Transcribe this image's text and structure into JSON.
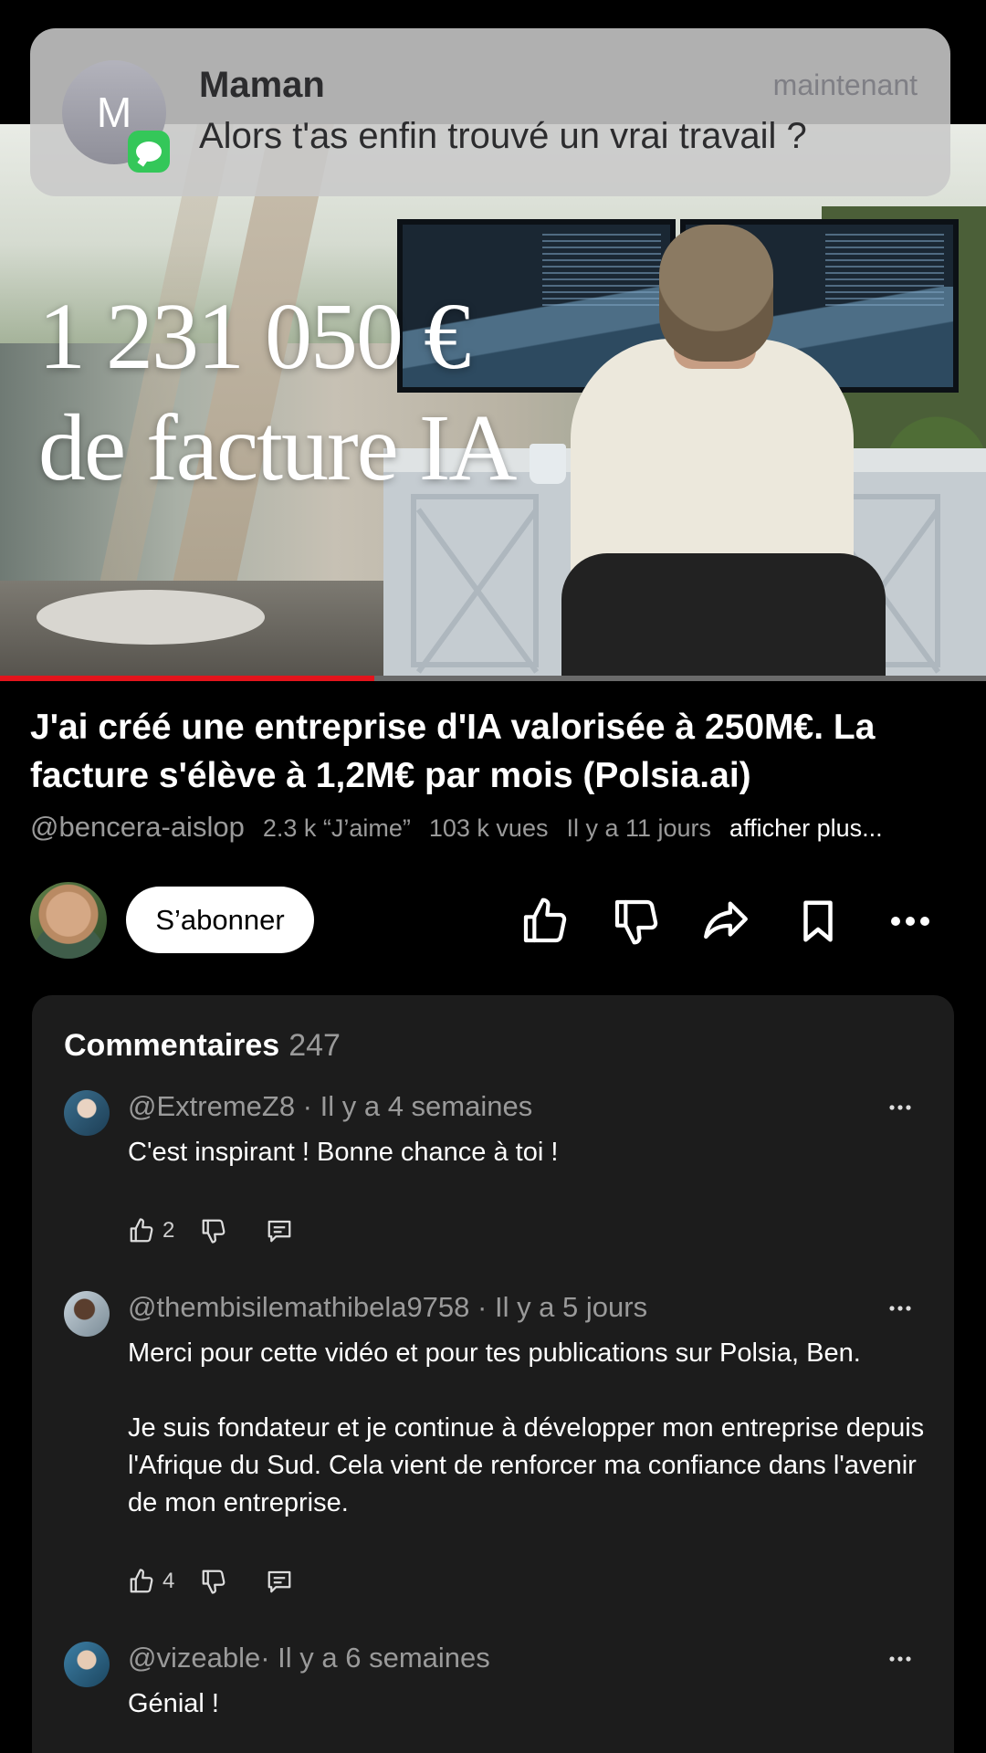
{
  "notification": {
    "avatar_letter": "M",
    "sender": "Maman",
    "time": "maintenant",
    "message": "Alors t'as enfin trouvé un vrai travail ?",
    "app_icon": "messages-icon"
  },
  "video": {
    "overlay_line1": "1 231 050 €",
    "overlay_line2": "de facture IA",
    "progress": 0.38,
    "progress_color": "#e4141c"
  },
  "title": "J'ai créé une entreprise d'IA valorisée à 250M€. La facture s'élève à 1,2M€ par mois (Polsia.ai)",
  "meta": {
    "channel": "@bencera-aislop",
    "likes": "2.3 k “J’aime”",
    "views": "103 k vues",
    "age": "Il y a 11 jours",
    "more": "afficher plus..."
  },
  "actions": {
    "subscribe": "S’abonner",
    "icons": [
      "thumbs-up-icon",
      "thumbs-down-icon",
      "share-icon",
      "bookmark-icon",
      "more-icon"
    ]
  },
  "comments": {
    "title": "Commentaires",
    "count": "247",
    "items": [
      {
        "author_line": "@ExtremeZ8 · Il y a 4 semaines",
        "text": "C'est inspirant ! Bonne chance à toi !",
        "likes": "2"
      },
      {
        "author_line": "@thembisilemathibela9758 · Il y a 5 jours",
        "text": "Merci pour cette vidéo et pour tes publications sur Polsia, Ben.\n\nJe suis fondateur et je continue à développer mon entreprise depuis l'Afrique du Sud. Cela vient de renforcer ma confiance dans l'avenir de mon entreprise.",
        "likes": "4"
      },
      {
        "author_line": "@vizeable· Il y a 6 semaines",
        "text": "Génial !",
        "likes": ""
      }
    ]
  }
}
